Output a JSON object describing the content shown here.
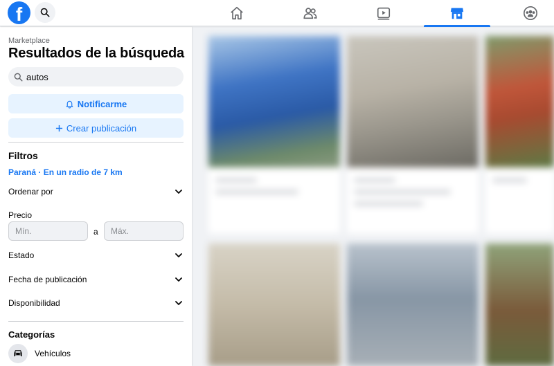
{
  "colors": {
    "brand": "#1877f2",
    "brand_soft": "#e7f3ff",
    "page_bg": "#f0f2f5"
  },
  "topbar": {
    "logo": "f",
    "search_icon": "search-icon",
    "nav": [
      {
        "name": "home-icon",
        "active": false
      },
      {
        "name": "friends-icon",
        "active": false
      },
      {
        "name": "watch-icon",
        "active": false
      },
      {
        "name": "marketplace-icon",
        "active": true
      },
      {
        "name": "groups-icon",
        "active": false
      }
    ]
  },
  "sidebar": {
    "breadcrumb": "Marketplace",
    "title": "Resultados de la búsqueda",
    "search": {
      "value": "autos",
      "icon": "search-icon"
    },
    "notify_button": "Notificarme",
    "create_button": "Crear publicación",
    "filters_title": "Filtros",
    "location": "Paraná · En un radio de 7 km",
    "sort_by": "Ordenar por",
    "price": {
      "label": "Precio",
      "min_placeholder": "Mín.",
      "separator": "a",
      "max_placeholder": "Máx."
    },
    "condition": "Estado",
    "date_listed": "Fecha de publicación",
    "availability": "Disponibilidad",
    "categories_title": "Categorías",
    "categories": [
      {
        "label": "Vehículos",
        "icon": "car-icon"
      }
    ]
  }
}
